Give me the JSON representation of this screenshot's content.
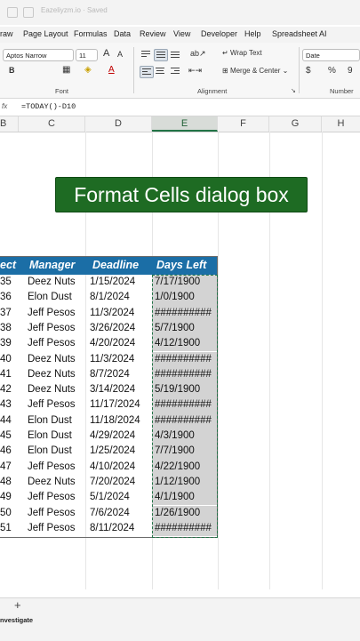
{
  "window": {
    "doc_name": "Eazeliyzm.io · Saved"
  },
  "tabs": [
    "raw",
    "Page Layout",
    "Formulas",
    "Data",
    "Review",
    "View",
    "Developer",
    "Help",
    "Spreadsheet AI"
  ],
  "ribbon": {
    "font_name": "Aptos Narrow",
    "font_size": "11",
    "wrap_text": "Wrap Text",
    "merge_center": "Merge & Center",
    "number_format": "Date",
    "group_font": "Font",
    "group_alignment": "Alignment",
    "group_number": "Number",
    "bold": "B",
    "grow_font": "A",
    "shrink_font": "A",
    "currency": "$",
    "percent": "%",
    "comma": "9"
  },
  "formula_bar": {
    "fx": "fx",
    "formula": "=TODAY()-D10"
  },
  "columns": [
    "B",
    "C",
    "D",
    "E",
    "F",
    "G",
    "H"
  ],
  "banner": "Format Cells dialog box",
  "table": {
    "headers": [
      "ect",
      "Manager",
      "Deadline",
      "Days Left"
    ],
    "rows": [
      [
        "35",
        "Deez Nuts",
        "1/15/2024",
        "7/17/1900"
      ],
      [
        "36",
        "Elon Dust",
        "8/1/2024",
        "1/0/1900"
      ],
      [
        "37",
        "Jeff Pesos",
        "11/3/2024",
        "##########"
      ],
      [
        "38",
        "Jeff Pesos",
        "3/26/2024",
        "5/7/1900"
      ],
      [
        "39",
        "Jeff Pesos",
        "4/20/2024",
        "4/12/1900"
      ],
      [
        "40",
        "Deez Nuts",
        "11/3/2024",
        "##########"
      ],
      [
        "41",
        "Deez Nuts",
        "8/7/2024",
        "##########"
      ],
      [
        "42",
        "Deez Nuts",
        "3/14/2024",
        "5/19/1900"
      ],
      [
        "43",
        "Jeff Pesos",
        "11/17/2024",
        "##########"
      ],
      [
        "44",
        "Elon Dust",
        "11/18/2024",
        "##########"
      ],
      [
        "45",
        "Elon Dust",
        "4/29/2024",
        "4/3/1900"
      ],
      [
        "46",
        "Elon Dust",
        "1/25/2024",
        "7/7/1900"
      ],
      [
        "47",
        "Jeff Pesos",
        "4/10/2024",
        "4/22/1900"
      ],
      [
        "48",
        "Deez Nuts",
        "7/20/2024",
        "1/12/1900"
      ],
      [
        "49",
        "Jeff Pesos",
        "5/1/2024",
        "4/1/1900"
      ],
      [
        "50",
        "Jeff Pesos",
        "7/6/2024",
        "1/26/1900"
      ],
      [
        "51",
        "Jeff Pesos",
        "8/11/2024",
        "##########"
      ]
    ]
  },
  "footer": {
    "add_sheet": "+",
    "status": "nvestigate"
  },
  "colors": {
    "header_blue": "#1b6ea6",
    "banner_green": "#1e6b23",
    "selection_gray": "#d3d3d3",
    "excel_green": "#217346"
  }
}
